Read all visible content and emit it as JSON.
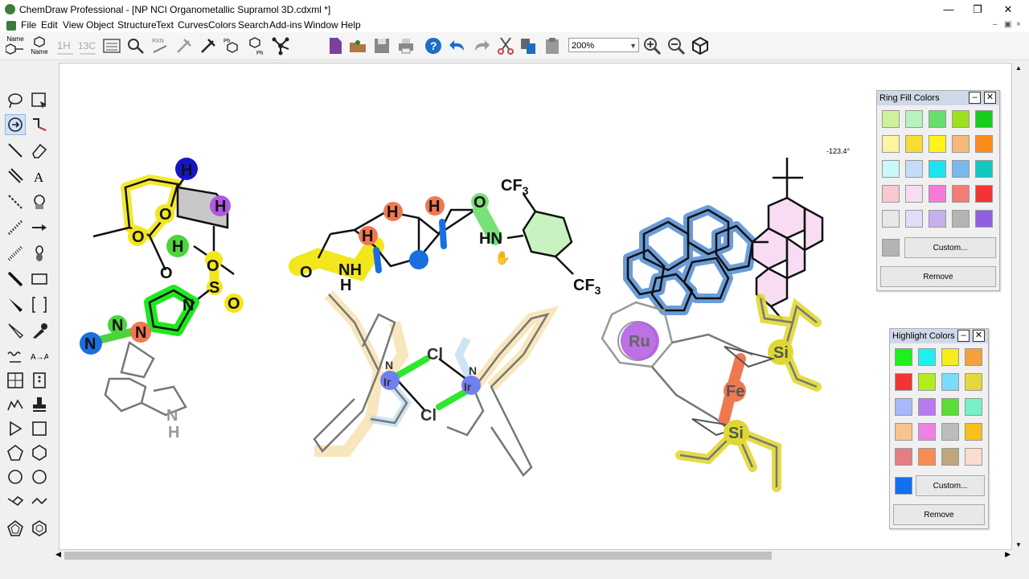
{
  "window": {
    "title": "ChemDraw Professional - [NP NCI Organometallic Supramol 3D.cdxml *]"
  },
  "menu": [
    "File",
    "Edit",
    "View",
    "Object",
    "Structure",
    "Text",
    "Curves",
    "Colors",
    "Search",
    "Add-ins",
    "Window",
    "Help"
  ],
  "toolbar": {
    "zoom_value": "200%",
    "buttons": [
      "name-to-structure",
      "structure-to-name",
      "predict-1h-nmr",
      "predict-13c-nmr",
      "analysis",
      "reaction-interpreter",
      "rxn",
      "clean-reaction",
      "clean-structure",
      "ph-lookup",
      "ph-expand",
      "clean-up",
      "new-document",
      "open",
      "save",
      "print",
      "help",
      "undo",
      "redo",
      "cut",
      "copy",
      "paste",
      "zoom-in",
      "zoom-out",
      "3d-view"
    ]
  },
  "tool_labels": {
    "name": "Name"
  },
  "canvas": {
    "angle_readout": "-123.4°",
    "labels": {
      "cf3_top": "CF",
      "cf3_sub": "3",
      "cf3_right": "CF",
      "cf3_right_sub": "3",
      "hn": "HN",
      "o_amide": "O",
      "o_lactam": "O",
      "nh": "NH",
      "h_small": "H",
      "cl1": "Cl",
      "cl2": "Cl",
      "ir1": "Ir",
      "ir2": "Ir",
      "n_ir1": "N",
      "n_ir2": "N",
      "ru": "Ru",
      "fe": "Fe",
      "si1": "Si",
      "si2": "Si",
      "n_azet": "N",
      "n1": "N",
      "n2": "N",
      "n3": "N",
      "o_sulfonyl1": "O",
      "o_sulfonyl2": "O",
      "s": "S",
      "nh_pyrrole": "N",
      "h_pyrrole": "H",
      "h_blue": "H",
      "h_purple": "H",
      "h_green": "H",
      "o_red": "O",
      "o_ring": "O",
      "o_ketone": "O",
      "h_red1": "H",
      "h_red2": "H",
      "h_red3": "H"
    }
  },
  "ring_fill_colors": {
    "title": "Ring Fill Colors",
    "swatches": [
      "#ccf29a",
      "#b8f2c0",
      "#66e06c",
      "#9de020",
      "#16cc1c",
      "#fbf5a0",
      "#f8dc30",
      "#fff51a",
      "#f8b878",
      "#fa8c1a",
      "#c8f8fa",
      "#c4dcf8",
      "#1ae4f0",
      "#7ab8ee",
      "#10c8c0",
      "#f8c8cc",
      "#f8dcf4",
      "#f87ad8",
      "#f47c78",
      "#f23434",
      "#e8e8e8",
      "#e2dcf8",
      "#c8b0ee",
      "#b4b4b4",
      "#9060e0"
    ],
    "extra_swatch": "#b4b4b4",
    "custom_label": "Custom...",
    "remove_label": "Remove"
  },
  "highlight_colors": {
    "title": "Highlight Colors",
    "swatches": [
      "#1ef01e",
      "#1ef0f0",
      "#f5ec1a",
      "#f5a03c",
      "#f23434",
      "#b0ee1a",
      "#7adcf8",
      "#e6d83c",
      "#a8b8f8",
      "#b878ee",
      "#5cdc38",
      "#78f0c8",
      "#f8c48c",
      "#f080e6",
      "#bcbcbc",
      "#f8c01a",
      "#e67c84",
      "#fa8c50",
      "#bca87c",
      "#fadcd0"
    ],
    "extra_swatch": "#1070f0",
    "custom_label": "Custom...",
    "remove_label": "Remove"
  }
}
